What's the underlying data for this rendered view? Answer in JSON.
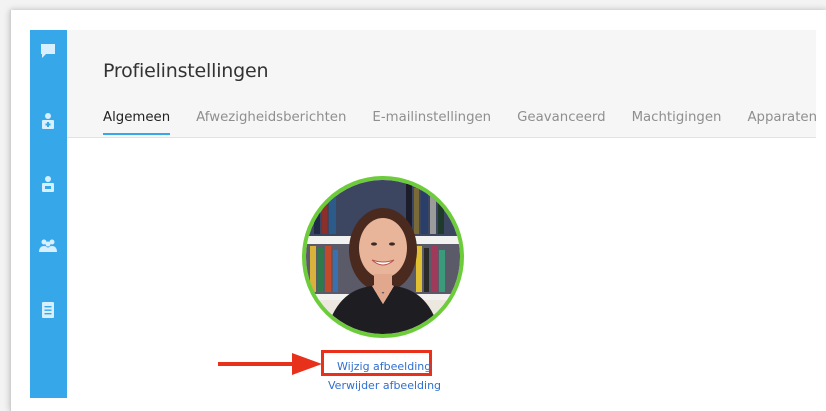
{
  "page": {
    "title": "Profielinstellingen"
  },
  "tabs": [
    {
      "label": "Algemeen",
      "active": true
    },
    {
      "label": "Afwezigheidsberichten",
      "active": false
    },
    {
      "label": "E-mailinstellingen",
      "active": false
    },
    {
      "label": "Geavanceerd",
      "active": false
    },
    {
      "label": "Machtigingen",
      "active": false
    },
    {
      "label": "Apparaten",
      "active": false
    }
  ],
  "sidebar": {
    "items": [
      {
        "icon": "chat-icon"
      },
      {
        "icon": "contact-card-icon"
      },
      {
        "icon": "person-badge-icon"
      },
      {
        "icon": "group-icon"
      },
      {
        "icon": "document-icon"
      }
    ]
  },
  "profile": {
    "change_picture": "Wijzig afbeelding",
    "remove_picture": "Verwijder afbeelding"
  },
  "colors": {
    "sidebar": "#36a8ea",
    "accent": "#36a8ea",
    "avatar_ring": "#6ccc3a",
    "link": "#2f6fd0",
    "annotation": "#e8311a"
  }
}
